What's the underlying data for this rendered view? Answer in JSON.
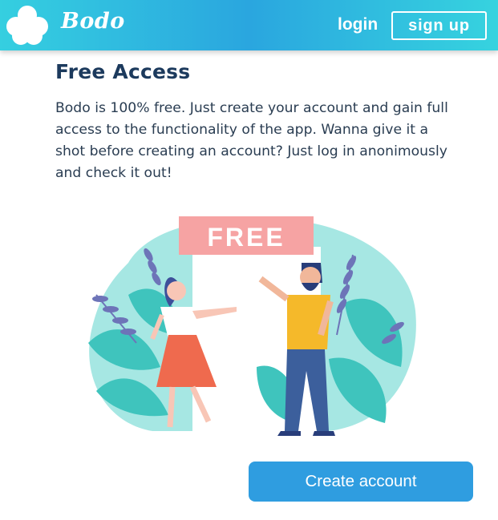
{
  "header": {
    "logo_text": "Bodo",
    "logo_icon": "clover-icon",
    "login_label": "login",
    "signup_label": "sign up"
  },
  "main": {
    "title": "Free Access",
    "description": "Bodo is 100% free. Just create your account and gain full access to the functionality of the app. Wanna give it a shot before creating an account? Just log in anonimously and check it out!",
    "illustration_banner": "FREE",
    "create_account_label": "Create account"
  },
  "colors": {
    "header_gradient_start": "#35cfe0",
    "header_gradient_mid": "#2aa6df",
    "title": "#1c3a5d",
    "button": "#2f9de0",
    "illustration_bg": "#a6e7e3",
    "banner": "#f6a3a3"
  }
}
